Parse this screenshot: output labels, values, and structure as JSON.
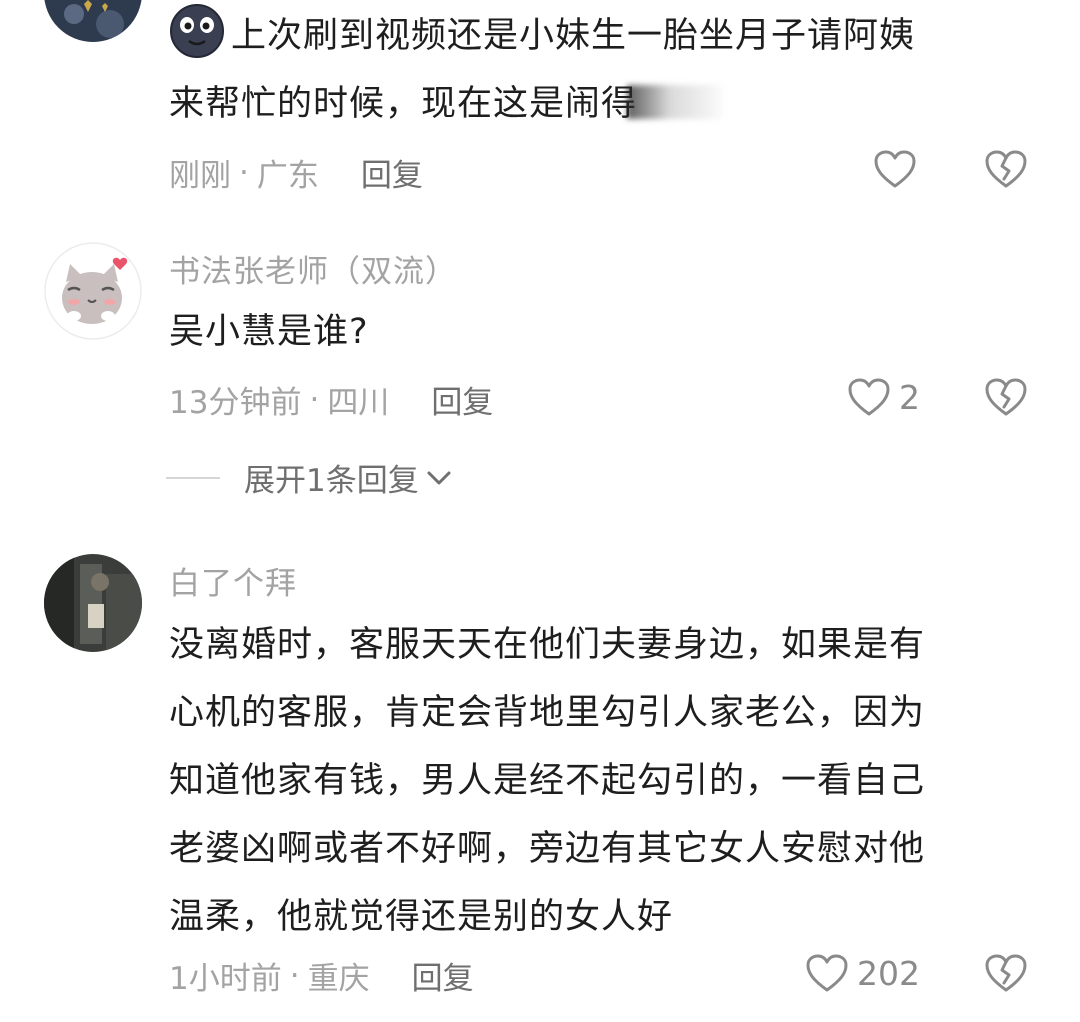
{
  "comments": [
    {
      "text_line1": "上次刷到视频还是小妹生一胎坐月子请阿姨",
      "text_line2": "来帮忙的时候，现在这是闹得",
      "time": "刚刚",
      "location": "广东",
      "reply_label": "回复",
      "like_count": ""
    },
    {
      "username": "书法张老师（双流）",
      "text": "吴小慧是谁?",
      "time": "13分钟前",
      "location": "四川",
      "reply_label": "回复",
      "like_count": "2",
      "expand_label": "展开1条回复"
    },
    {
      "username": "白了个拜",
      "text_lines": [
        "没离婚时，客服天天在他们夫妻身边，如果是有",
        "心机的客服，肯定会背地里勾引人家老公，因为",
        "知道他家有钱，男人是经不起勾引的，一看自己",
        "老婆凶啊或者不好啊，旁边有其它女人安慰对他",
        "温柔，他就觉得还是别的女人好"
      ],
      "time": "1小时前",
      "location": "重庆",
      "reply_label": "回复",
      "like_count": "202"
    }
  ],
  "separator": "·",
  "icons": {
    "like": "heart-outline-icon",
    "dislike": "broken-heart-icon",
    "expand": "chevron-down-icon",
    "emoji": "smiling-face-emoji-icon"
  },
  "colors": {
    "text": "#1e1e1e",
    "meta": "#a3a3a3",
    "reply": "#6f6f6f",
    "icon": "#8a8a8a"
  }
}
